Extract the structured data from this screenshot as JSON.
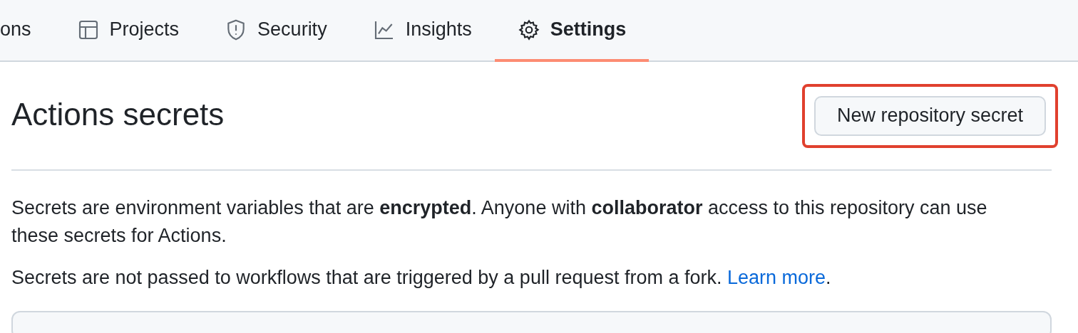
{
  "tabs": [
    {
      "label": "ons",
      "selected": false
    },
    {
      "label": "Projects",
      "selected": false
    },
    {
      "label": "Security",
      "selected": false
    },
    {
      "label": "Insights",
      "selected": false
    },
    {
      "label": "Settings",
      "selected": true
    }
  ],
  "heading": "Actions secrets",
  "new_secret_button": {
    "label": "New repository secret",
    "highlighted": true
  },
  "description": "Secrets are environment variables that are **encrypted**. Anyone with **collaborator** access to this repository can use these secrets for Actions.",
  "fork_note": {
    "text": "Secrets are not passed to workflows that are triggered by a pull request from a fork.",
    "link": "Learn more",
    "suffix": "."
  }
}
